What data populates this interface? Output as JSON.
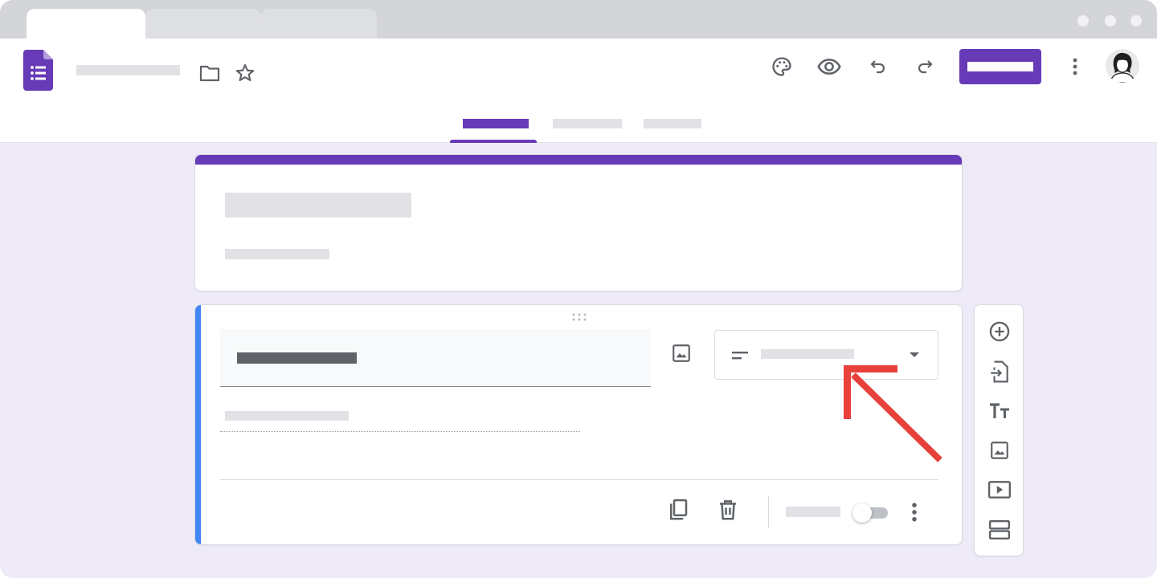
{
  "browser": {
    "tabs": [
      {
        "label": "",
        "active": true
      },
      {
        "label": "",
        "active": false
      },
      {
        "label": "",
        "active": false
      }
    ],
    "window_controls": [
      "dot-icon",
      "dot-icon",
      "dot-icon"
    ]
  },
  "header": {
    "logo_icon": "google-forms-icon",
    "form_title": "",
    "icons": [
      "folder-icon",
      "star-icon",
      "palette-icon",
      "eye-icon",
      "undo-icon",
      "redo-icon",
      "more-vert-icon"
    ],
    "send_label": "",
    "nav_tabs": [
      {
        "label": "",
        "active": true
      },
      {
        "label": "",
        "active": false
      },
      {
        "label": "",
        "active": false
      }
    ]
  },
  "form": {
    "title": "",
    "description": "",
    "question": {
      "text": "",
      "type_label": "",
      "type_icon": "short-answer-icon",
      "answer_placeholder": "",
      "required_label": "",
      "required": false
    }
  },
  "side_toolbar": {
    "icons": [
      "add-question-icon",
      "import-questions-icon",
      "add-title-icon",
      "add-image-icon",
      "add-video-icon",
      "add-section-icon"
    ]
  },
  "annotation": {
    "type": "arrow",
    "color": "#e8403a",
    "points_to": "question-type-select"
  },
  "colors": {
    "accent": "#673ab7",
    "question_bar": "#4285f4",
    "page_background": "#eeeaf8",
    "icon": "#5f6368"
  }
}
